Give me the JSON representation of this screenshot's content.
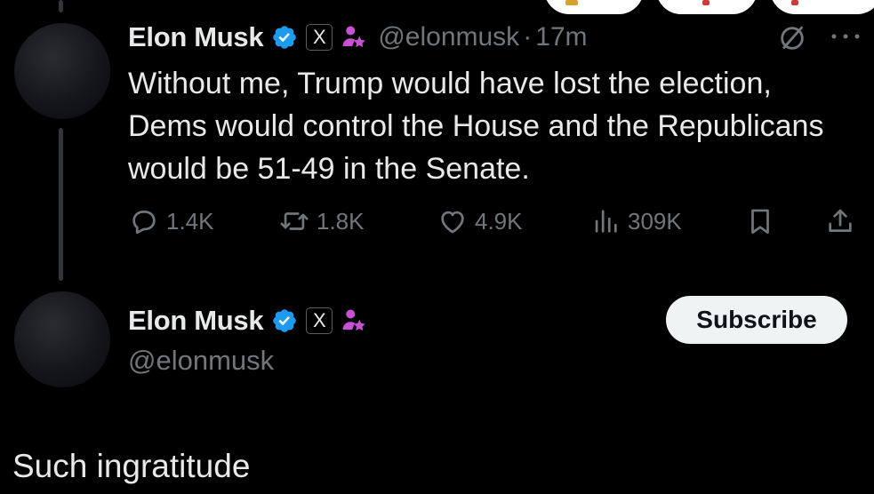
{
  "post": {
    "author_name": "Elon Musk",
    "handle": "@elonmusk",
    "separator": "·",
    "time": "17m",
    "text": "Without me, Trump would have lost the election, Dems would control the House and the Republicans would be 51-49 in the Senate.",
    "affiliation_badge": "X",
    "stats": {
      "replies": "1.4K",
      "reposts": "1.8K",
      "likes": "4.9K",
      "views": "309K"
    }
  },
  "profile_card": {
    "author_name": "Elon Musk",
    "handle": "@elonmusk",
    "affiliation_badge": "X",
    "subscribe_label": "Subscribe"
  },
  "caption": "Such ingratitude",
  "colors": {
    "background": "#000000",
    "primary_text": "#e7e9ea",
    "secondary_text": "#71767b",
    "verified_blue": "#1d9bf0",
    "role_icon": "#c94fd6",
    "thread_line": "#333639"
  }
}
